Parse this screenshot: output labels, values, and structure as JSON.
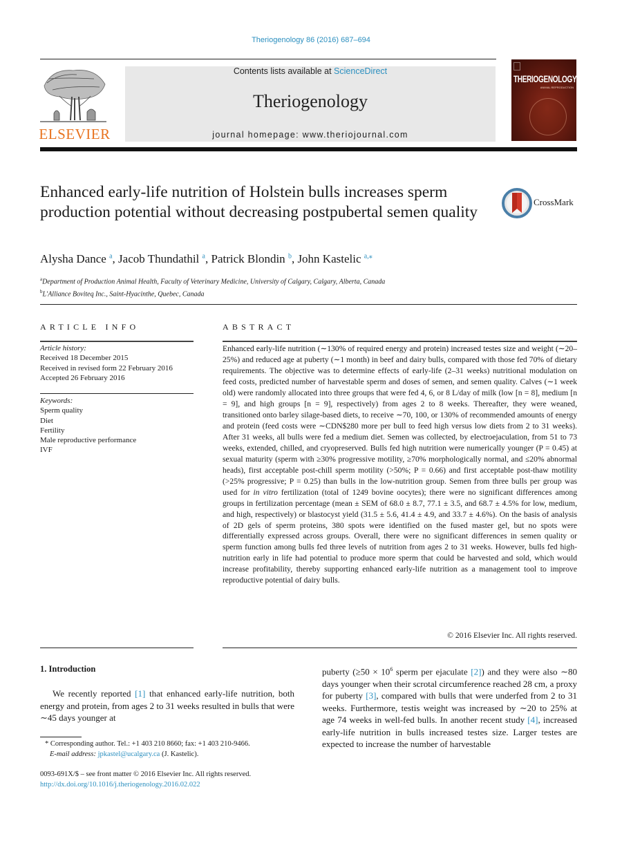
{
  "header": {
    "citation": "Theriogenology 86 (2016) 687–694",
    "publisher_logo_text": "ELSEVIER",
    "contents_prefix": "Contents lists available at ",
    "contents_link": "ScienceDirect",
    "journal_name": "Theriogenology",
    "homepage": "journal homepage: www.theriojournal.com",
    "cover_title": "THERIOGENOLOGY",
    "cover_subtitle": "ANIMAL REPRODUCTION"
  },
  "article": {
    "title": "Enhanced early-life nutrition of Holstein bulls increases sperm production potential without decreasing postpubertal semen quality",
    "crossmark_label": "CrossMark",
    "authors": [
      {
        "name": "Alysha Dance",
        "aff": "a",
        "sep": ", "
      },
      {
        "name": "Jacob Thundathil",
        "aff": "a",
        "sep": ", "
      },
      {
        "name": "Patrick Blondin",
        "aff": "b",
        "sep": ", "
      },
      {
        "name": "John Kastelic",
        "aff": "a,⁎",
        "sep": ""
      }
    ],
    "affiliations": [
      {
        "key": "a",
        "text": "Department of Production Animal Health, Faculty of Veterinary Medicine, University of Calgary, Calgary, Alberta, Canada"
      },
      {
        "key": "b",
        "text": "L'Alliance Boviteq Inc., Saint-Hyacinthe, Quebec, Canada"
      }
    ]
  },
  "article_info": {
    "heading": "ARTICLE INFO",
    "history_label": "Article history:",
    "history": [
      "Received 18 December 2015",
      "Received in revised form 22 February 2016",
      "Accepted 26 February 2016"
    ],
    "keywords_label": "Keywords:",
    "keywords": [
      "Sperm quality",
      "Diet",
      "Fertility",
      "Male reproductive performance",
      "IVF"
    ]
  },
  "abstract": {
    "heading": "ABSTRACT",
    "part1": "Enhanced early-life nutrition (∼130% of required energy and protein) increased testes size and weight (∼20–25%) and reduced age at puberty (∼1 month) in beef and dairy bulls, compared with those fed 70% of dietary requirements. The objective was to determine effects of early-life (2–31 weeks) nutritional modulation on feed costs, predicted number of harvestable sperm and doses of semen, and semen quality. Calves (∼1 week old) were randomly allocated into three groups that were fed 4, 6, or 8 L/day of milk (low [n = 8], medium [n = 9], and high groups [n = 9], respectively) from ages 2 to 8 weeks. Thereafter, they were weaned, transitioned onto barley silage-based diets, to receive ∼70, 100, or 130% of recommended amounts of energy and protein (feed costs were ∼CDN$280 more per bull to feed high versus low diets from 2 to 31 weeks). After 31 weeks, all bulls were fed a medium diet. Semen was collected, by electroejaculation, from 51 to 73 weeks, extended, chilled, and cryopreserved. Bulls fed high nutrition were numerically younger (P = 0.45) at sexual maturity (sperm with ≥30% progressive motility, ≥70% morphologically normal, and ≤20% abnormal heads), first acceptable post-chill sperm motility (>50%; P = 0.66) and first acceptable post-thaw motility (>25% progressive; P = 0.25) than bulls in the low-nutrition group. Semen from three bulls per group was used for ",
    "italic": "in vitro",
    "part2": " fertilization (total of 1249 bovine oocytes); there were no significant differences among groups in fertilization percentage (mean ± SEM of 68.0 ± 8.7, 77.1 ± 3.5, and 68.7 ± 4.5% for low, medium, and high, respectively) or blastocyst yield (31.5 ± 5.6, 41.4 ± 4.9, and 33.7 ± 4.6%). On the basis of analysis of 2D gels of sperm proteins, 380 spots were identified on the fused master gel, but no spots were differentially expressed across groups. Overall, there were no significant differences in semen quality or sperm function among bulls fed three levels of nutrition from ages 2 to 31 weeks. However, bulls fed high-nutrition early in life had potential to produce more sperm that could be harvested and sold, which would increase profitability, thereby supporting enhanced early-life nutrition as a management tool to improve reproductive potential of dairy bulls.",
    "copyright": "© 2016 Elsevier Inc. All rights reserved."
  },
  "introduction": {
    "heading": "1.  Introduction",
    "col1_a": "We recently reported ",
    "ref1": "[1]",
    "col1_b": " that enhanced early-life nutrition, both energy and protein, from ages 2 to 31 weeks resulted in bulls that were ∼45 days younger at",
    "col2_a": "puberty (≥50 × 10",
    "col2_sup": "6",
    "col2_b": " sperm per ejaculate ",
    "ref2": "[2]",
    "col2_c": ") and they were also ∼80 days younger when their scrotal circumference reached 28 cm, a proxy for puberty ",
    "ref3": "[3]",
    "col2_d": ", compared with bulls that were underfed from 2 to 31 weeks. Furthermore, testis weight was increased by ∼20 to 25% at age 74 weeks in well-fed bulls. In another recent study ",
    "ref4": "[4]",
    "col2_e": ", increased early-life nutrition in bulls increased testes size. Larger testes are expected to increase the number of harvestable"
  },
  "footnote": {
    "marker": "*",
    "corresponding": " Corresponding author. Tel.: +1 403 210 8660; fax: +1 403 210-9466.",
    "email_label": "E-mail address: ",
    "email": "jpkastel@ucalgary.ca",
    "email_suffix": " (J. Kastelic).",
    "front_matter": "0093-691X/$ – see front matter © 2016 Elsevier Inc. All rights reserved.",
    "doi": "http://dx.doi.org/10.1016/j.theriogenology.2016.02.022"
  },
  "colors": {
    "link": "#2b8fbf",
    "elsevier_orange": "#e8731f",
    "banner_bg": "#e8e8e8",
    "cover_red": "#6e1e12"
  }
}
